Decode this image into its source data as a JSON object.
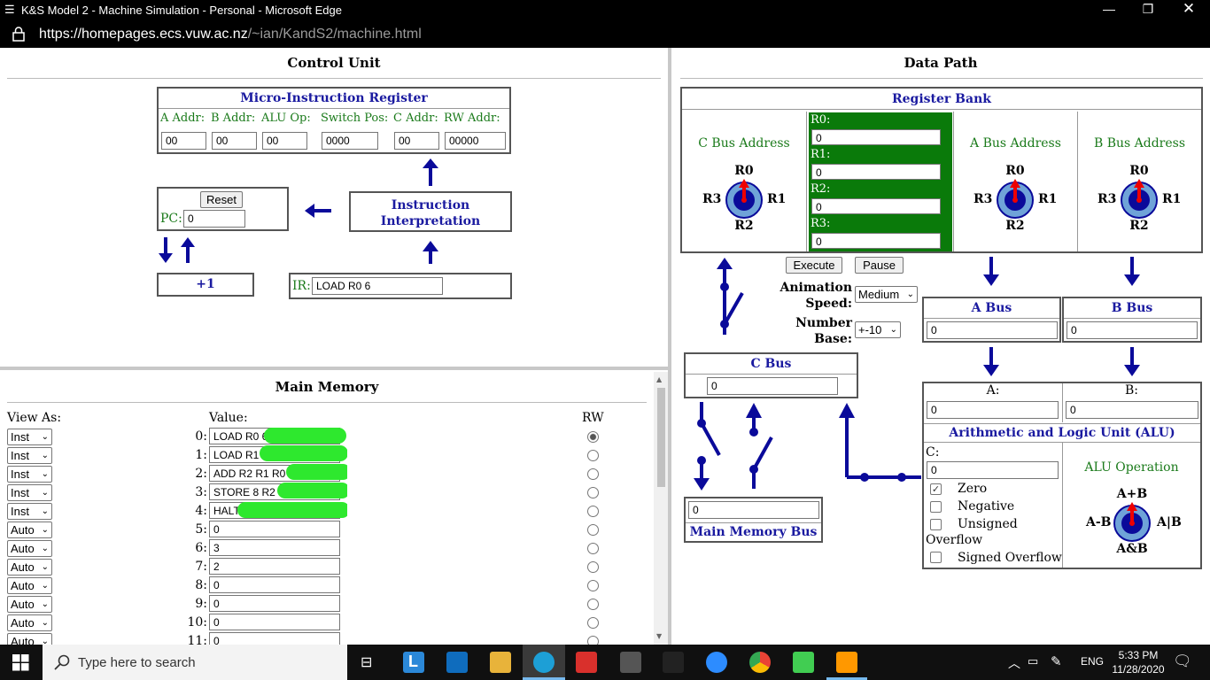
{
  "window": {
    "title": "K&S Model 2 - Machine Simulation - Personal - Microsoft Edge",
    "url_main": "https://homepages.ecs.vuw.ac.nz",
    "url_path": "/~ian/KandS2/machine.html"
  },
  "control_unit": {
    "title": "Control Unit",
    "mir": {
      "title": "Micro-Instruction Register",
      "headers": [
        "A Addr:",
        "B Addr:",
        "ALU Op:",
        "Switch Pos:",
        "C Addr:",
        "RW Addr:"
      ],
      "values": [
        "00",
        "00",
        "00",
        "0000",
        "00",
        "00000"
      ]
    },
    "reset_label": "Reset",
    "pc_label": "PC:",
    "pc_value": "0",
    "instr_interp_line1": "Instruction",
    "instr_interp_line2": "Interpretation",
    "plus_one": "+1",
    "ir_label": "IR:",
    "ir_value": "LOAD R0 6"
  },
  "main_memory": {
    "title": "Main Memory",
    "view_as_label": "View As:",
    "value_label": "Value:",
    "rw_label": "RW",
    "rows": [
      {
        "view": "Inst",
        "addr": "0:",
        "value": "LOAD R0 6",
        "rw": true
      },
      {
        "view": "Inst",
        "addr": "1:",
        "value": "LOAD R1 7",
        "rw": false
      },
      {
        "view": "Inst",
        "addr": "2:",
        "value": "ADD R2 R1 R0",
        "rw": false
      },
      {
        "view": "Inst",
        "addr": "3:",
        "value": "STORE 8 R2",
        "rw": false
      },
      {
        "view": "Inst",
        "addr": "4:",
        "value": "HALT",
        "rw": false
      },
      {
        "view": "Auto",
        "addr": "5:",
        "value": "0",
        "rw": false
      },
      {
        "view": "Auto",
        "addr": "6:",
        "value": "3",
        "rw": false
      },
      {
        "view": "Auto",
        "addr": "7:",
        "value": "2",
        "rw": false
      },
      {
        "view": "Auto",
        "addr": "8:",
        "value": "0",
        "rw": false
      },
      {
        "view": "Auto",
        "addr": "9:",
        "value": "0",
        "rw": false
      },
      {
        "view": "Auto",
        "addr": "10:",
        "value": "0",
        "rw": false
      },
      {
        "view": "Auto",
        "addr": "11:",
        "value": "0",
        "rw": false
      }
    ]
  },
  "data_path": {
    "title": "Data Path",
    "register_bank": {
      "title": "Register Bank",
      "c_bus_address": "C Bus Address",
      "a_bus_address": "A Bus Address",
      "b_bus_address": "B Bus Address",
      "registers": [
        {
          "label": "R0:",
          "value": "0"
        },
        {
          "label": "R1:",
          "value": "0"
        },
        {
          "label": "R2:",
          "value": "0"
        },
        {
          "label": "R3:",
          "value": "0"
        }
      ],
      "dial_labels": {
        "top": "R0",
        "left": "R3",
        "right": "R1",
        "bottom": "R2"
      }
    },
    "execute_label": "Execute",
    "pause_label": "Pause",
    "animation_speed_label_1": "Animation",
    "animation_speed_label_2": "Speed:",
    "animation_speed_value": "Medium",
    "number_base_label_1": "Number",
    "number_base_label_2": "Base:",
    "number_base_value": "+-10",
    "a_bus": {
      "title": "A Bus",
      "value": "0"
    },
    "b_bus": {
      "title": "B Bus",
      "value": "0"
    },
    "c_bus": {
      "title": "C Bus",
      "value": "0"
    },
    "main_memory_bus": {
      "title": "Main Memory Bus",
      "value": "0"
    },
    "alu": {
      "a_label": "A:",
      "a_value": "0",
      "b_label": "B:",
      "b_value": "0",
      "title": "Arithmetic and Logic Unit (ALU)",
      "c_label": "C:",
      "c_value": "0",
      "flags": [
        {
          "label": "Zero",
          "checked": true
        },
        {
          "label": "Negative",
          "checked": false
        },
        {
          "label": "Unsigned",
          "checked": false
        }
      ],
      "overflow_label": "Overflow",
      "signed_overflow_label": "Signed Overflow",
      "operation_label": "ALU Operation",
      "dial_labels": {
        "top": "A+B",
        "left": "A-B",
        "right": "A|B",
        "bottom": "A&B"
      }
    }
  },
  "taskbar": {
    "search_placeholder": "Type here to search",
    "language": "ENG",
    "time": "5:33 PM",
    "date": "11/28/2020"
  }
}
